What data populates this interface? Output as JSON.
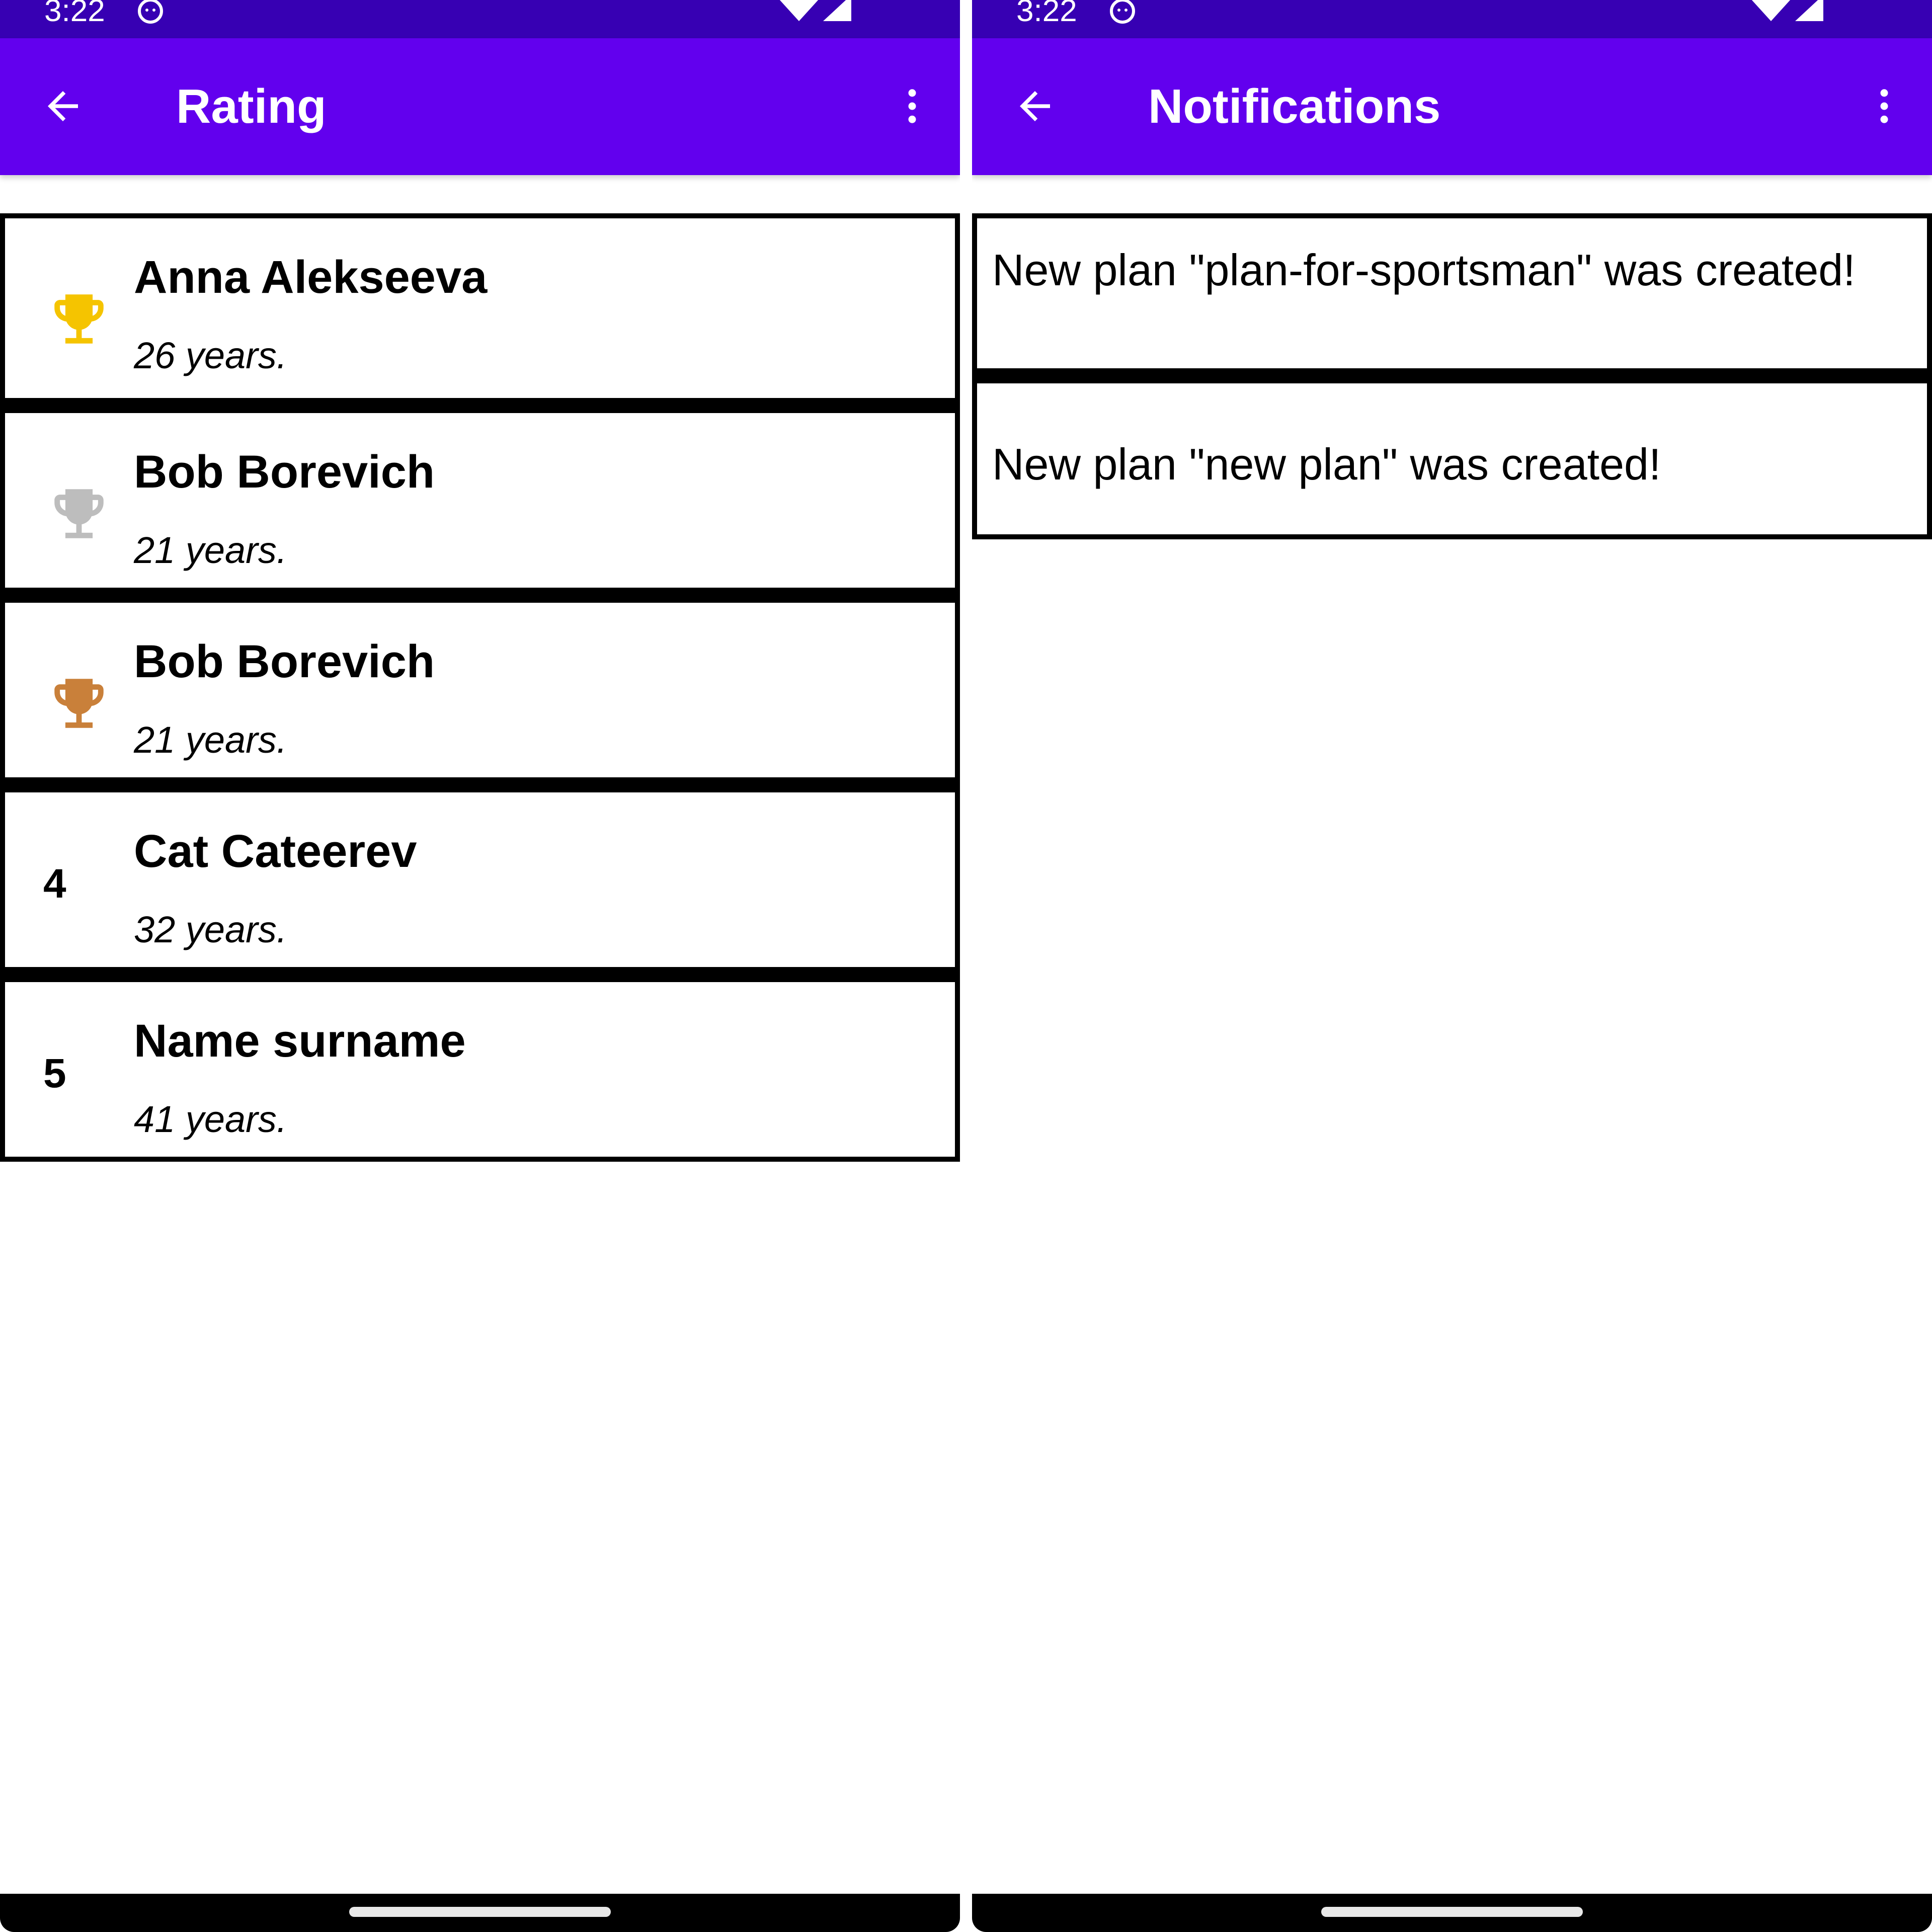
{
  "colors": {
    "status_bar": "#3700b3",
    "app_bar": "#6200ee",
    "gold": "#f5c400",
    "silver": "#bdbdbd",
    "bronze": "#c9803a"
  },
  "rating_screen": {
    "status": {
      "time": "3:22"
    },
    "title": "Rating",
    "back_icon": "arrow-back-icon",
    "menu_icon": "more-vert-icon",
    "rows": [
      {
        "rank_icon": "trophy-gold-icon",
        "name": "Anna Alekseeva",
        "age": "26 years."
      },
      {
        "rank_icon": "trophy-silver-icon",
        "name": "Bob Borevich",
        "age": "21 years."
      },
      {
        "rank_icon": "trophy-bronze-icon",
        "name": "Bob Borevich",
        "age": "21 years."
      },
      {
        "rank": "4",
        "name": "Cat Cateerev",
        "age": "32 years."
      },
      {
        "rank": "5",
        "name": "Name surname",
        "age": "41 years."
      }
    ]
  },
  "notifications_screen": {
    "status": {
      "time": "3:22"
    },
    "title": "Notifications",
    "back_icon": "arrow-back-icon",
    "menu_icon": "more-vert-icon",
    "items": [
      {
        "text": "New plan \"plan-for-sportsman\" was created!"
      },
      {
        "text": "New plan \"new plan\" was created!"
      }
    ]
  }
}
